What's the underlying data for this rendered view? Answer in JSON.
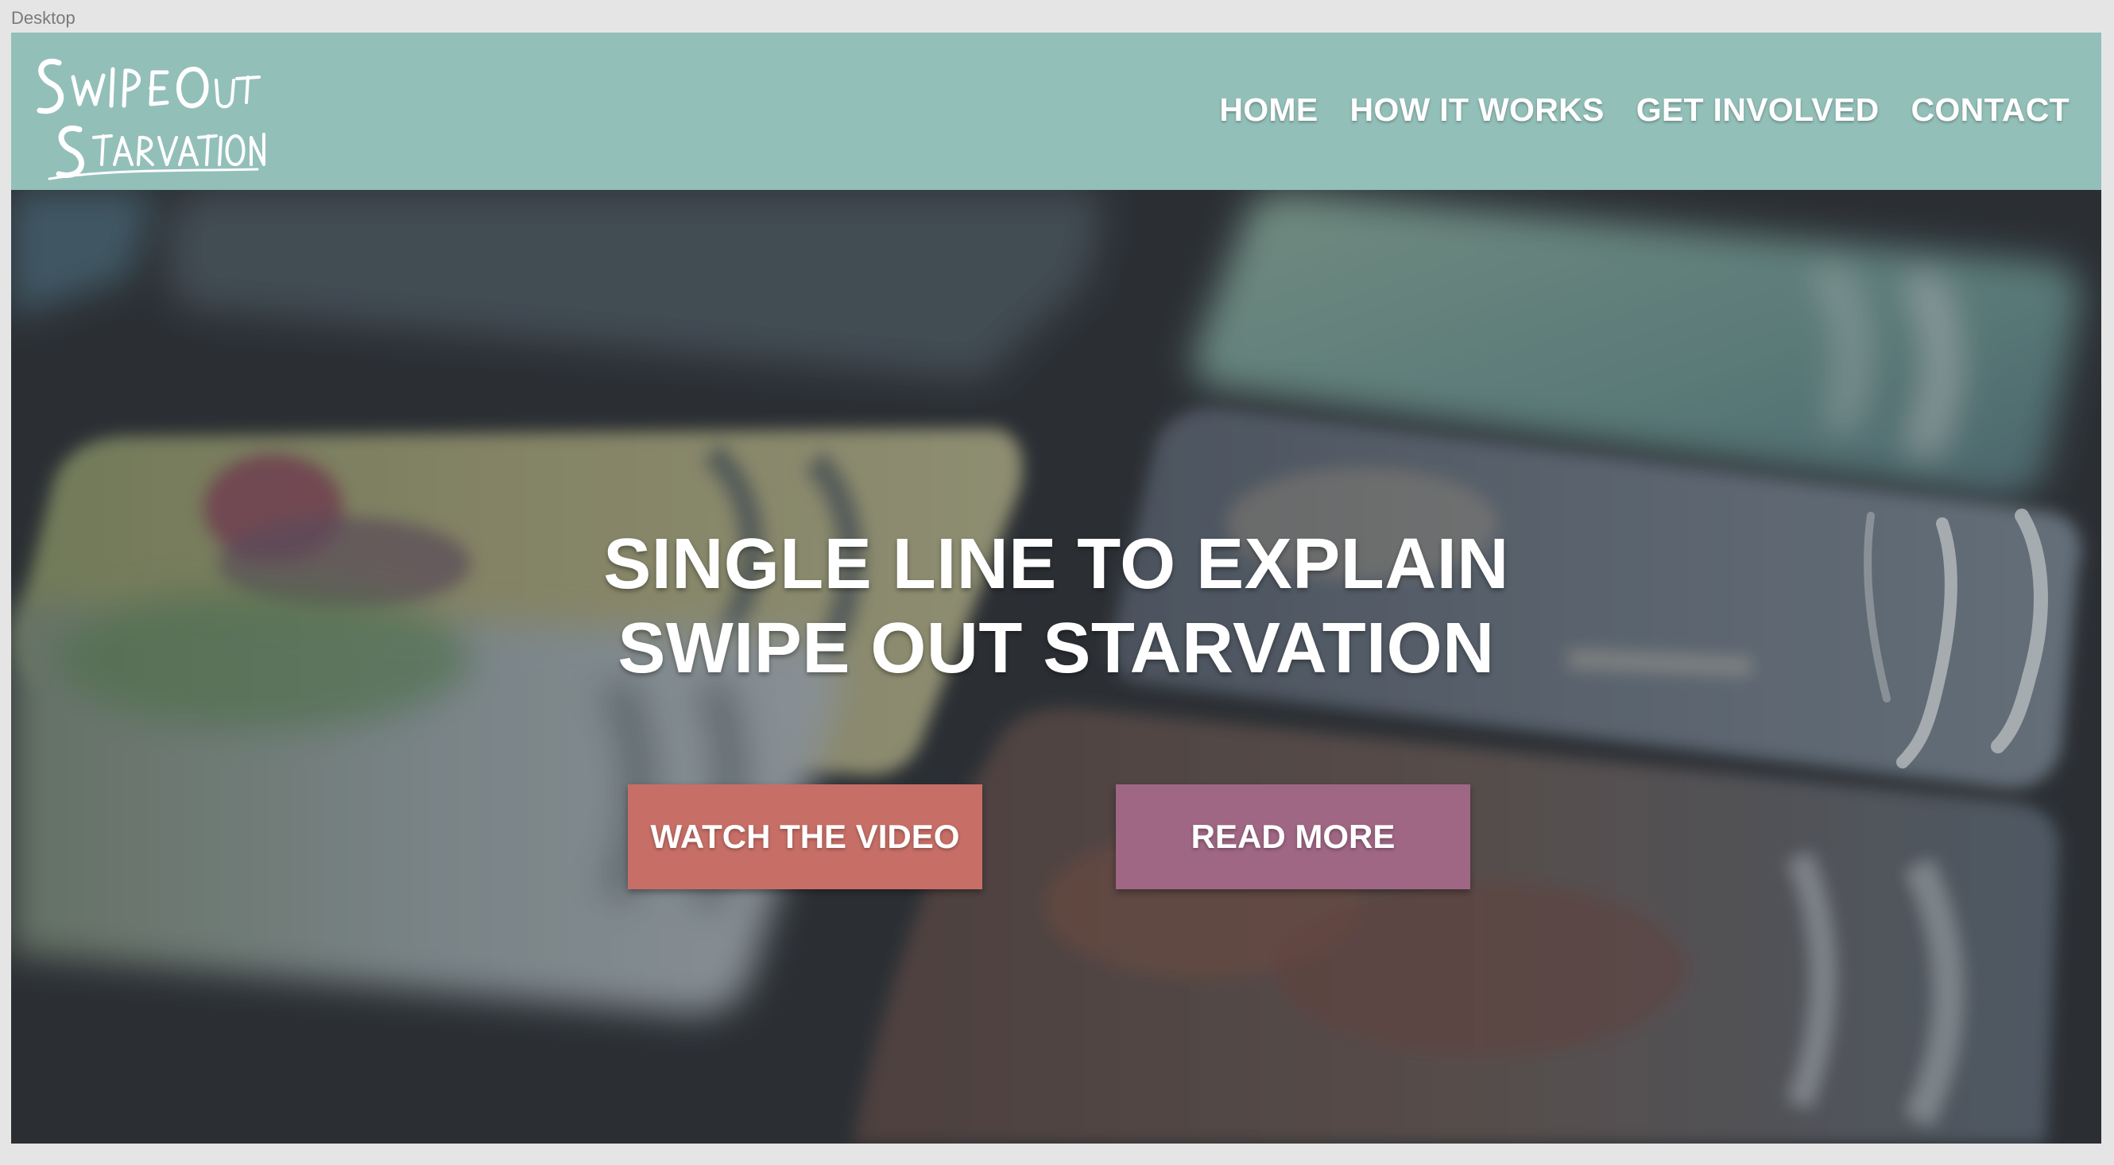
{
  "artboard": {
    "label": "Desktop"
  },
  "header": {
    "logo": {
      "line1": "SwipeOut",
      "line2": "Starvation",
      "icon": "swipe-out-starvation-logo"
    },
    "nav": [
      {
        "label": "HOME"
      },
      {
        "label": "HOW IT WORKS"
      },
      {
        "label": "GET INVOLVED"
      },
      {
        "label": "CONTACT"
      }
    ]
  },
  "hero": {
    "title_line1": "SINGLE LINE TO EXPLAIN",
    "title_line2": "SWIPE OUT STARVATION",
    "watch_label": "WATCH THE VIDEO",
    "read_label": "READ MORE"
  },
  "colors": {
    "header_bg": "#93bfb9",
    "watch_button": "#c76f67",
    "read_button": "#9f6784",
    "text": "#ffffff"
  }
}
